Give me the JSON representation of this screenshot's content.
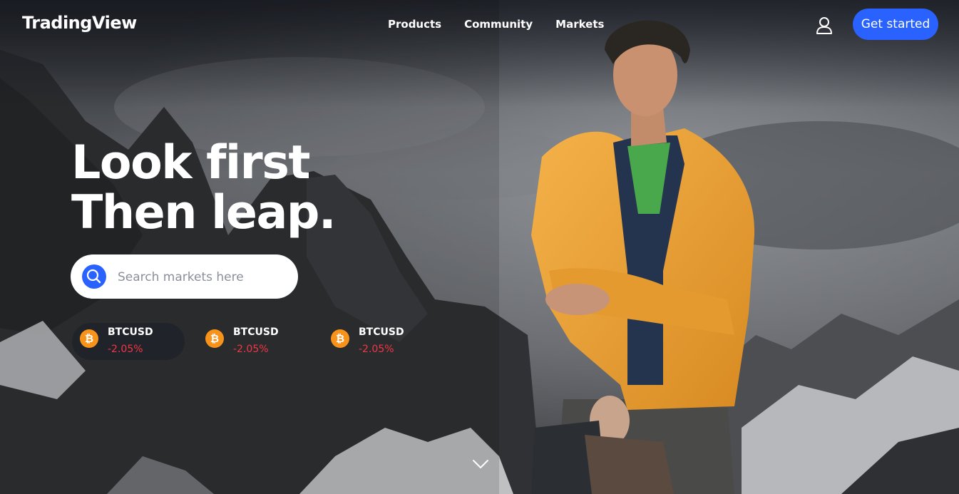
{
  "header": {
    "logo": "TradingView",
    "nav": [
      {
        "label": "Products"
      },
      {
        "label": "Community"
      },
      {
        "label": "Markets"
      }
    ],
    "cta_label": "Get started",
    "user_icon": "user-icon"
  },
  "hero": {
    "headline_line1": "Look first",
    "headline_line2": "Then leap."
  },
  "search": {
    "placeholder": "Search markets here",
    "icon": "search-icon"
  },
  "tickers": [
    {
      "symbol": "BTCUSD",
      "change": "-2.05%",
      "icon": "bitcoin-icon"
    },
    {
      "symbol": "BTCUSD",
      "change": "-2.05%",
      "icon": "bitcoin-icon"
    },
    {
      "symbol": "BTCUSD",
      "change": "-2.05%",
      "icon": "bitcoin-icon"
    }
  ],
  "colors": {
    "accent": "#2962ff",
    "negative": "#f23645",
    "bitcoin": "#f7931a",
    "jacket": "#f0a53a"
  },
  "scroll_icon": "chevron-down-icon"
}
